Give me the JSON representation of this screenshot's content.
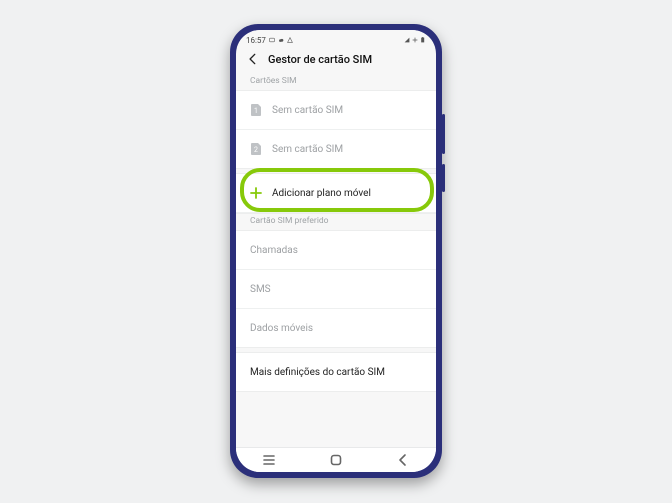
{
  "statusbar": {
    "time": "16:57"
  },
  "appbar": {
    "title": "Gestor de cartão SIM"
  },
  "sections": {
    "sim_cards_label": "Cartões SIM",
    "preferred_label": "Cartão SIM preferido"
  },
  "sim_slots": [
    {
      "index_glyph": "1",
      "text": "Sem cartão SIM"
    },
    {
      "index_glyph": "2",
      "text": "Sem cartão SIM"
    }
  ],
  "add_plan": {
    "label": "Adicionar plano móvel"
  },
  "preferred": {
    "calls": "Chamadas",
    "sms": "SMS",
    "data": "Dados móveis"
  },
  "more_settings": {
    "label": "Mais definições do cartão SIM"
  },
  "colors": {
    "highlight": "#87c90a"
  }
}
